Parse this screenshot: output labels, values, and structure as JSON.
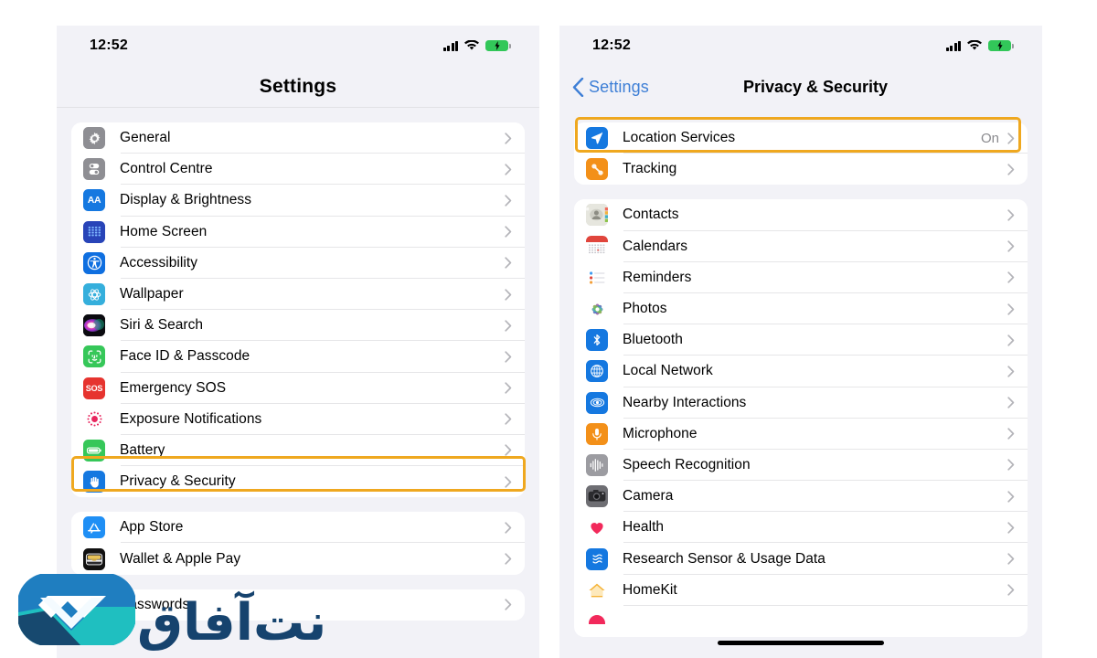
{
  "statusbar": {
    "time": "12:52",
    "signal_icon": "cellular-signal-icon",
    "wifi_icon": "wifi-icon",
    "battery_icon": "battery-charging-icon"
  },
  "left_phone": {
    "nav": {
      "title": "Settings"
    },
    "groups": [
      {
        "id": "system-group",
        "rows": [
          {
            "label": "General",
            "icon": "gear-icon",
            "icon_bg": "#8e8e93",
            "value": ""
          },
          {
            "label": "Control Centre",
            "icon": "control-centre-icon",
            "icon_bg": "#8e8e93",
            "value": ""
          },
          {
            "label": "Display & Brightness",
            "icon": "display-brightness-icon",
            "icon_bg": "#1578e0",
            "value": ""
          },
          {
            "label": "Home Screen",
            "icon": "home-screen-icon",
            "icon_bg": "#2844b8",
            "value": ""
          },
          {
            "label": "Accessibility",
            "icon": "accessibility-icon",
            "icon_bg": "#0f6fe0",
            "value": ""
          },
          {
            "label": "Wallpaper",
            "icon": "wallpaper-icon",
            "icon_bg": "#35afdc",
            "value": ""
          },
          {
            "label": "Siri & Search",
            "icon": "siri-search-icon",
            "icon_bg": "#101010",
            "value": ""
          },
          {
            "label": "Face ID & Passcode",
            "icon": "face-id-icon",
            "icon_bg": "#36c759",
            "value": ""
          },
          {
            "label": "Emergency SOS",
            "icon": "emergency-sos-icon",
            "icon_bg": "#e6342f",
            "value": ""
          },
          {
            "label": "Exposure Notifications",
            "icon": "exposure-notifications-icon",
            "icon_bg": "#ffffff",
            "value": ""
          },
          {
            "label": "Battery",
            "icon": "battery-icon",
            "icon_bg": "#36c759",
            "value": ""
          },
          {
            "label": "Privacy & Security",
            "icon": "privacy-hand-icon",
            "icon_bg": "#1578e0",
            "value": ""
          }
        ]
      },
      {
        "id": "store-group",
        "rows": [
          {
            "label": "App Store",
            "icon": "app-store-icon",
            "icon_bg": "#1f8ff5",
            "value": ""
          },
          {
            "label": "Wallet & Apple Pay",
            "icon": "wallet-icon",
            "icon_bg": "#111111",
            "value": ""
          }
        ]
      },
      {
        "id": "passwords-group",
        "rows": [
          {
            "label": "Passwords",
            "icon": "passwords-key-icon",
            "icon_bg": "#8e8e93",
            "value": ""
          }
        ]
      }
    ],
    "highlight": {
      "label": "privacy-security-highlight"
    }
  },
  "right_phone": {
    "nav": {
      "back_label": "Settings",
      "title": "Privacy & Security"
    },
    "groups": [
      {
        "id": "location-group",
        "rows": [
          {
            "label": "Location Services",
            "icon": "location-arrow-icon",
            "icon_bg": "#1578e0",
            "value": "On"
          },
          {
            "label": "Tracking",
            "icon": "tracking-icon",
            "icon_bg": "#f39019",
            "value": ""
          }
        ]
      },
      {
        "id": "permissions-group",
        "rows": [
          {
            "label": "Contacts",
            "icon": "contacts-icon",
            "icon_bg": "#d8d8d0",
            "value": ""
          },
          {
            "label": "Calendars",
            "icon": "calendar-icon",
            "icon_bg": "#ffffff",
            "value": ""
          },
          {
            "label": "Reminders",
            "icon": "reminders-icon",
            "icon_bg": "#ffffff",
            "value": ""
          },
          {
            "label": "Photos",
            "icon": "photos-icon",
            "icon_bg": "#ffffff",
            "value": ""
          },
          {
            "label": "Bluetooth",
            "icon": "bluetooth-icon",
            "icon_bg": "#1578e0",
            "value": ""
          },
          {
            "label": "Local Network",
            "icon": "local-network-icon",
            "icon_bg": "#1578e0",
            "value": ""
          },
          {
            "label": "Nearby Interactions",
            "icon": "nearby-interactions-icon",
            "icon_bg": "#1578e0",
            "value": ""
          },
          {
            "label": "Microphone",
            "icon": "microphone-icon",
            "icon_bg": "#f39019",
            "value": ""
          },
          {
            "label": "Speech Recognition",
            "icon": "speech-recognition-icon",
            "icon_bg": "#9c9ca1",
            "value": ""
          },
          {
            "label": "Camera",
            "icon": "camera-icon",
            "icon_bg": "#6e6e73",
            "value": ""
          },
          {
            "label": "Health",
            "icon": "health-heart-icon",
            "icon_bg": "#ffffff",
            "value": ""
          },
          {
            "label": "Research Sensor & Usage Data",
            "icon": "research-sensor-icon",
            "icon_bg": "#1578e0",
            "value": ""
          },
          {
            "label": "HomeKit",
            "icon": "homekit-icon",
            "icon_bg": "#ffffff",
            "value": ""
          },
          {
            "label": "",
            "icon": "media-apple-music-icon",
            "icon_bg": "#ffffff",
            "value": ""
          }
        ]
      }
    ],
    "highlight": {
      "label": "location-services-highlight"
    }
  },
  "watermark": {
    "text": "نت‌آفاق",
    "logo": "narmafzar-logo"
  },
  "colors": {
    "highlight": "#efa81f",
    "accent_blue": "#3e7fd6",
    "page_bg": "#f2f2f7",
    "row_bg": "#ffffff",
    "value_gray": "#8a8a8e"
  }
}
